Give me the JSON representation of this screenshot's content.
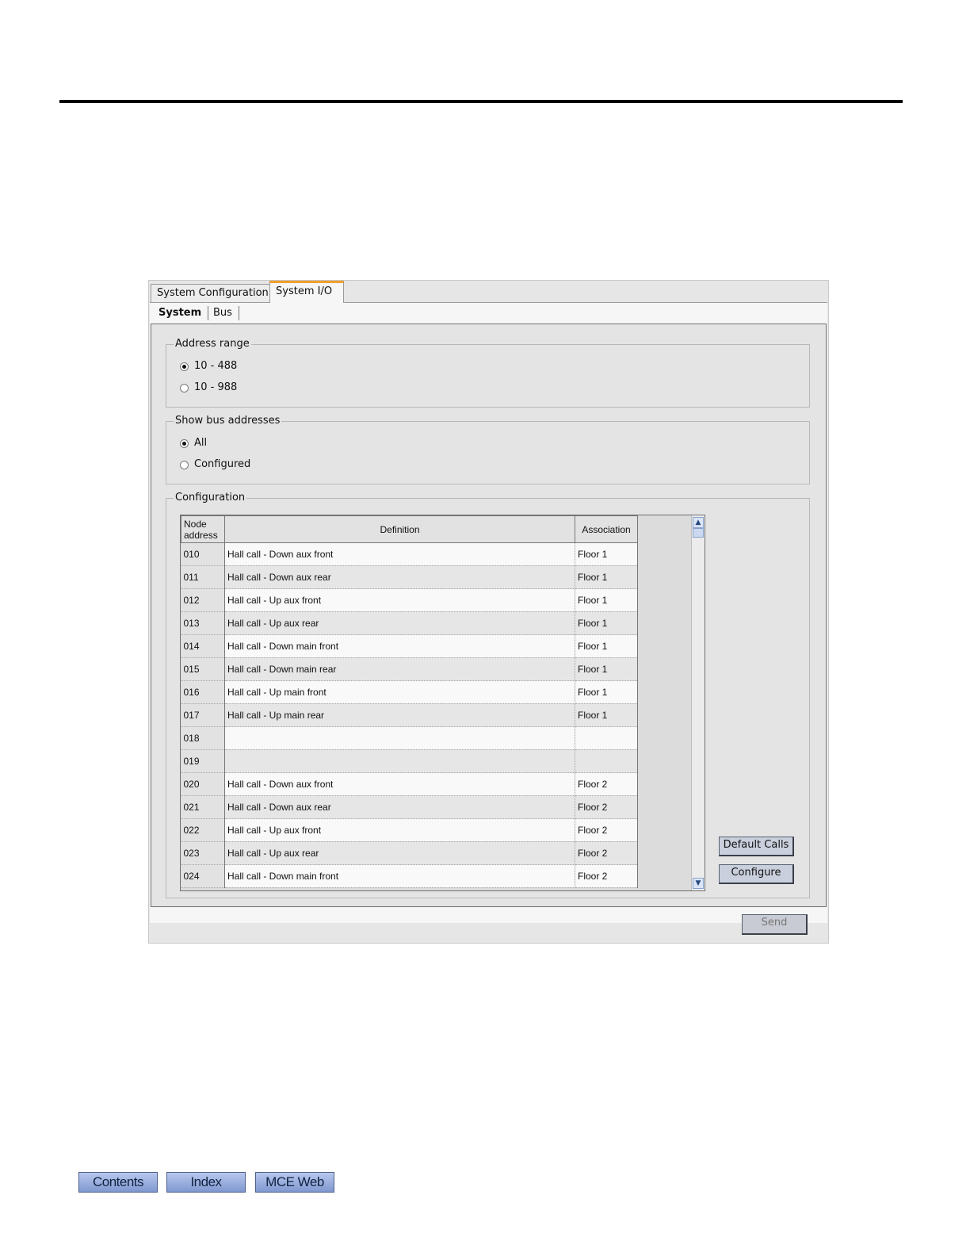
{
  "tabs": [
    "System Configuration",
    "System I/O"
  ],
  "active_tab": "System I/O",
  "subtabs": [
    "System",
    "Bus"
  ],
  "address_range": {
    "legend": "Address range",
    "options": [
      "10 - 488",
      "10 - 988"
    ],
    "selected": "10 - 488"
  },
  "show_bus_addresses": {
    "legend": "Show bus addresses",
    "options": [
      "All",
      "Configured"
    ],
    "selected": "All"
  },
  "configuration": {
    "legend": "Configuration",
    "columns": [
      "Node address",
      "Definition",
      "Association"
    ],
    "rows": [
      {
        "node": "010",
        "definition": "Hall call - Down aux front",
        "association": "Floor 1"
      },
      {
        "node": "011",
        "definition": "Hall call - Down aux rear",
        "association": "Floor 1"
      },
      {
        "node": "012",
        "definition": "Hall call - Up aux front",
        "association": "Floor 1"
      },
      {
        "node": "013",
        "definition": "Hall call - Up aux rear",
        "association": "Floor 1"
      },
      {
        "node": "014",
        "definition": "Hall call - Down main front",
        "association": "Floor 1"
      },
      {
        "node": "015",
        "definition": "Hall call - Down main rear",
        "association": "Floor 1"
      },
      {
        "node": "016",
        "definition": "Hall call - Up main front",
        "association": "Floor 1"
      },
      {
        "node": "017",
        "definition": "Hall call - Up main rear",
        "association": "Floor 1"
      },
      {
        "node": "018",
        "definition": "",
        "association": ""
      },
      {
        "node": "019",
        "definition": "",
        "association": ""
      },
      {
        "node": "020",
        "definition": "Hall call - Down aux front",
        "association": "Floor 2"
      },
      {
        "node": "021",
        "definition": "Hall call - Down aux rear",
        "association": "Floor 2"
      },
      {
        "node": "022",
        "definition": "Hall call - Up aux front",
        "association": "Floor 2"
      },
      {
        "node": "023",
        "definition": "Hall call - Up aux rear",
        "association": "Floor 2"
      },
      {
        "node": "024",
        "definition": "Hall call - Down main front",
        "association": "Floor 2"
      }
    ],
    "buttons": {
      "default_calls": "Default Calls",
      "configure": "Configure"
    }
  },
  "send_label": "Send",
  "footer_nav": [
    "Contents",
    "Index",
    "MCE Web"
  ],
  "colors": {
    "active_tab_accent": "#f0a030",
    "nav_button": "#8ea6db"
  }
}
